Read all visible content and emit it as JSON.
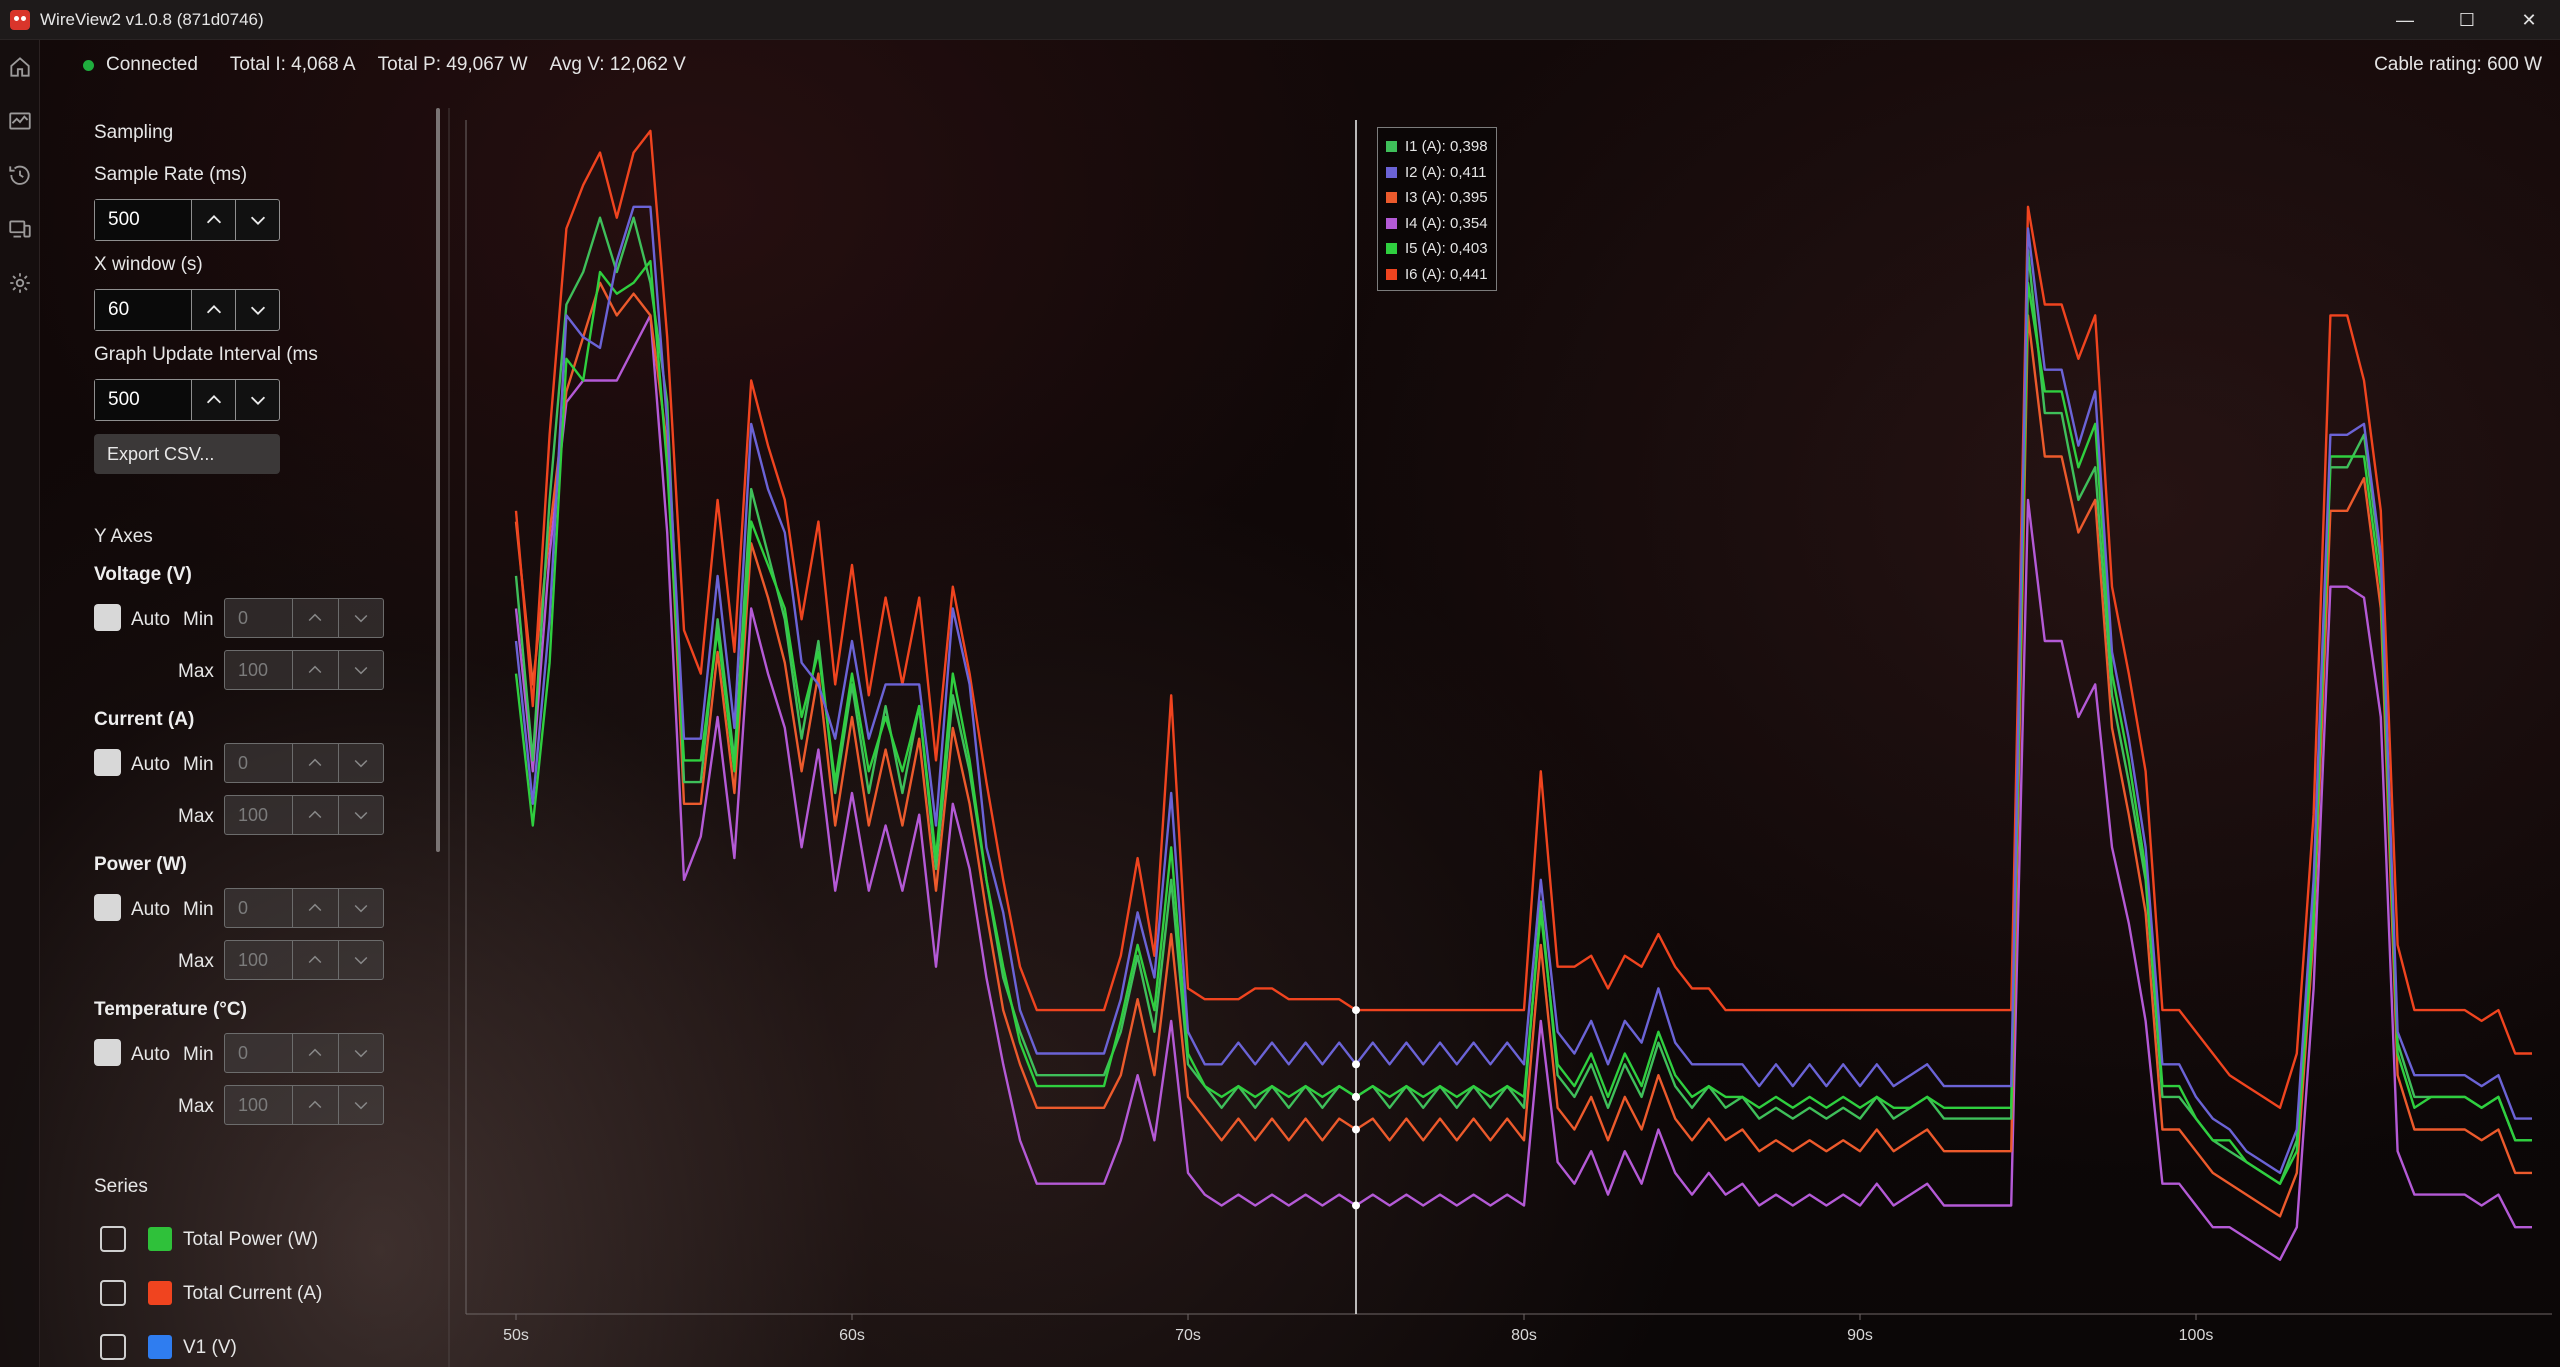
{
  "window": {
    "title": "WireView2 v1.0.8 (871d0746)",
    "controls": [
      "—",
      "☐",
      "✕"
    ]
  },
  "status": {
    "connection": "Connected",
    "total_i": "Total I: 4,068 A",
    "total_p": "Total P: 49,067 W",
    "avg_v": "Avg V: 12,062 V",
    "cable_rating": "Cable rating: 600 W"
  },
  "nav": [
    "home-icon",
    "monitor-graph-icon",
    "history-icon",
    "devices-icon",
    "settings-icon"
  ],
  "sampling": {
    "title": "Sampling",
    "sample_rate_label": "Sample Rate (ms)",
    "sample_rate_value": "500",
    "x_window_label": "X window (s)",
    "x_window_value": "60",
    "graph_update_label": "Graph Update Interval (ms",
    "graph_update_value": "500",
    "export_label": "Export CSV..."
  },
  "y_axes": {
    "title": "Y Axes",
    "auto_label": "Auto",
    "min_label": "Min",
    "max_label": "Max",
    "groups": [
      {
        "title": "Voltage (V)",
        "min": "0",
        "max": "100",
        "auto": true
      },
      {
        "title": "Current (A)",
        "min": "0",
        "max": "100",
        "auto": true
      },
      {
        "title": "Power (W)",
        "min": "0",
        "max": "100",
        "auto": true
      },
      {
        "title": "Temperature (°C)",
        "min": "0",
        "max": "100",
        "auto": true
      }
    ]
  },
  "series_panel": {
    "title": "Series",
    "items": [
      {
        "label": "Total Power (W)",
        "color": "#2fc13a",
        "checked": false
      },
      {
        "label": "Total Current (A)",
        "color": "#f0441f",
        "checked": false
      },
      {
        "label": "V1 (V)",
        "color": "#2f7df0",
        "checked": false
      }
    ]
  },
  "legend": [
    {
      "label": "I1 (A): 0,398",
      "color": "#3fbf5a"
    },
    {
      "label": "I2 (A): 0,411",
      "color": "#6b63d6"
    },
    {
      "label": "I3 (A): 0,395",
      "color": "#ec5a2c"
    },
    {
      "label": "I4 (A): 0,354",
      "color": "#b45ad6"
    },
    {
      "label": "I5 (A): 0,403",
      "color": "#2fcf3f"
    },
    {
      "label": "I6 (A): 0,441",
      "color": "#f0441f"
    }
  ],
  "chart_data": {
    "type": "line",
    "x_ticks": [
      "50s",
      "60s",
      "70s",
      "80s",
      "90s",
      "100s"
    ],
    "x_range": [
      50,
      110
    ],
    "y_range": [
      0,
      1.1
    ],
    "grid": false,
    "legend_position": "top, next to cursor",
    "cursor_x": 75,
    "x": [
      50,
      50.5,
      51,
      51.5,
      52,
      52.5,
      53,
      53.5,
      54,
      54.5,
      55,
      55.5,
      56,
      56.5,
      57,
      57.5,
      58,
      58.5,
      59,
      59.5,
      60,
      60.5,
      61,
      61.5,
      62,
      62.5,
      63,
      63.5,
      64,
      64.5,
      65,
      65.5,
      66,
      66.5,
      67,
      67.5,
      68,
      68.5,
      69,
      69.5,
      70,
      70.5,
      71,
      71.5,
      72,
      72.5,
      73,
      73.5,
      74,
      74.5,
      75,
      75.5,
      76,
      76.5,
      77,
      77.5,
      78,
      78.5,
      79,
      79.5,
      80,
      80.5,
      81,
      81.5,
      82,
      82.5,
      83,
      83.5,
      84,
      84.5,
      85,
      85.5,
      86,
      86.5,
      87,
      87.5,
      88,
      88.5,
      89,
      89.5,
      90,
      90.5,
      91,
      91.5,
      92,
      92.5,
      93,
      93.5,
      94,
      94.5,
      95,
      95.5,
      96,
      96.5,
      97,
      97.5,
      98,
      98.5,
      99,
      99.5,
      100,
      100.5,
      101,
      101.5,
      102,
      102.5,
      103,
      103.5,
      104,
      104.5,
      105,
      105.5,
      106,
      106.5,
      107,
      107.5,
      108,
      108.5,
      109,
      109.5,
      110
    ],
    "series": [
      {
        "name": "I1 (A)",
        "values": [
          0.68,
          0.51,
          0.75,
          0.93,
          0.96,
          1.01,
          0.96,
          1.01,
          0.95,
          0.84,
          0.49,
          0.49,
          0.64,
          0.51,
          0.76,
          0.7,
          0.64,
          0.53,
          0.62,
          0.48,
          0.58,
          0.48,
          0.56,
          0.48,
          0.56,
          0.41,
          0.57,
          0.5,
          0.4,
          0.31,
          0.26,
          0.22,
          0.22,
          0.22,
          0.22,
          0.22,
          0.26,
          0.33,
          0.26,
          0.4,
          0.23,
          0.21,
          0.19,
          0.21,
          0.19,
          0.21,
          0.19,
          0.21,
          0.19,
          0.21,
          0.2,
          0.21,
          0.19,
          0.21,
          0.19,
          0.21,
          0.19,
          0.21,
          0.19,
          0.21,
          0.19,
          0.38,
          0.22,
          0.2,
          0.23,
          0.19,
          0.23,
          0.2,
          0.25,
          0.21,
          0.19,
          0.21,
          0.19,
          0.2,
          0.18,
          0.19,
          0.18,
          0.19,
          0.18,
          0.19,
          0.18,
          0.2,
          0.18,
          0.19,
          0.2,
          0.18,
          0.18,
          0.18,
          0.18,
          0.18,
          0.98,
          0.83,
          0.83,
          0.75,
          0.78,
          0.57,
          0.49,
          0.4,
          0.2,
          0.2,
          0.18,
          0.16,
          0.15,
          0.14,
          0.13,
          0.12,
          0.16,
          0.38,
          0.78,
          0.78,
          0.81,
          0.69,
          0.25,
          0.2,
          0.2,
          0.2,
          0.2,
          0.19,
          0.2,
          0.16,
          0.16
        ]
      },
      {
        "name": "I2 (A)",
        "values": [
          0.62,
          0.47,
          0.64,
          0.92,
          0.9,
          0.89,
          0.97,
          1.02,
          1.02,
          0.82,
          0.53,
          0.53,
          0.68,
          0.54,
          0.82,
          0.76,
          0.72,
          0.6,
          0.58,
          0.53,
          0.62,
          0.53,
          0.58,
          0.58,
          0.58,
          0.45,
          0.65,
          0.58,
          0.43,
          0.37,
          0.28,
          0.24,
          0.24,
          0.24,
          0.24,
          0.24,
          0.29,
          0.37,
          0.31,
          0.48,
          0.26,
          0.23,
          0.23,
          0.25,
          0.23,
          0.25,
          0.23,
          0.25,
          0.23,
          0.25,
          0.23,
          0.25,
          0.23,
          0.25,
          0.23,
          0.25,
          0.23,
          0.25,
          0.23,
          0.25,
          0.23,
          0.4,
          0.26,
          0.24,
          0.27,
          0.23,
          0.27,
          0.25,
          0.3,
          0.25,
          0.23,
          0.23,
          0.23,
          0.23,
          0.21,
          0.23,
          0.21,
          0.23,
          0.21,
          0.23,
          0.21,
          0.23,
          0.21,
          0.22,
          0.23,
          0.21,
          0.21,
          0.21,
          0.21,
          0.21,
          1.0,
          0.87,
          0.87,
          0.8,
          0.85,
          0.61,
          0.53,
          0.43,
          0.23,
          0.23,
          0.2,
          0.18,
          0.17,
          0.15,
          0.14,
          0.13,
          0.17,
          0.4,
          0.81,
          0.81,
          0.82,
          0.7,
          0.26,
          0.22,
          0.22,
          0.22,
          0.22,
          0.21,
          0.22,
          0.18,
          0.18
        ]
      },
      {
        "name": "I3 (A)",
        "values": [
          0.73,
          0.58,
          0.72,
          0.85,
          0.9,
          0.95,
          0.92,
          0.94,
          0.92,
          0.8,
          0.47,
          0.47,
          0.61,
          0.48,
          0.71,
          0.66,
          0.6,
          0.5,
          0.59,
          0.45,
          0.55,
          0.45,
          0.52,
          0.45,
          0.53,
          0.39,
          0.54,
          0.47,
          0.37,
          0.28,
          0.23,
          0.19,
          0.19,
          0.19,
          0.19,
          0.19,
          0.22,
          0.29,
          0.22,
          0.35,
          0.2,
          0.18,
          0.16,
          0.18,
          0.16,
          0.18,
          0.16,
          0.18,
          0.16,
          0.18,
          0.17,
          0.18,
          0.16,
          0.18,
          0.16,
          0.18,
          0.16,
          0.18,
          0.16,
          0.18,
          0.16,
          0.34,
          0.19,
          0.17,
          0.2,
          0.16,
          0.2,
          0.17,
          0.22,
          0.18,
          0.16,
          0.18,
          0.16,
          0.17,
          0.15,
          0.16,
          0.15,
          0.16,
          0.15,
          0.16,
          0.15,
          0.17,
          0.15,
          0.16,
          0.17,
          0.15,
          0.15,
          0.15,
          0.15,
          0.15,
          0.92,
          0.79,
          0.79,
          0.72,
          0.75,
          0.54,
          0.46,
          0.37,
          0.17,
          0.17,
          0.15,
          0.13,
          0.12,
          0.11,
          0.1,
          0.09,
          0.13,
          0.35,
          0.74,
          0.74,
          0.77,
          0.65,
          0.22,
          0.17,
          0.17,
          0.17,
          0.17,
          0.16,
          0.17,
          0.13,
          0.13
        ]
      },
      {
        "name": "I4 (A)",
        "values": [
          0.65,
          0.5,
          0.7,
          0.84,
          0.86,
          0.86,
          0.86,
          0.89,
          0.92,
          0.72,
          0.4,
          0.44,
          0.55,
          0.42,
          0.65,
          0.59,
          0.54,
          0.43,
          0.52,
          0.39,
          0.48,
          0.39,
          0.45,
          0.39,
          0.46,
          0.32,
          0.47,
          0.41,
          0.31,
          0.23,
          0.16,
          0.12,
          0.12,
          0.12,
          0.12,
          0.12,
          0.16,
          0.22,
          0.16,
          0.27,
          0.13,
          0.11,
          0.1,
          0.11,
          0.1,
          0.11,
          0.1,
          0.11,
          0.1,
          0.11,
          0.1,
          0.11,
          0.1,
          0.11,
          0.1,
          0.11,
          0.1,
          0.11,
          0.1,
          0.11,
          0.1,
          0.27,
          0.14,
          0.12,
          0.15,
          0.11,
          0.15,
          0.12,
          0.17,
          0.13,
          0.11,
          0.13,
          0.11,
          0.12,
          0.1,
          0.11,
          0.1,
          0.11,
          0.1,
          0.11,
          0.1,
          0.12,
          0.1,
          0.11,
          0.12,
          0.1,
          0.1,
          0.1,
          0.1,
          0.1,
          0.75,
          0.62,
          0.62,
          0.55,
          0.58,
          0.43,
          0.36,
          0.27,
          0.12,
          0.12,
          0.1,
          0.08,
          0.08,
          0.07,
          0.06,
          0.05,
          0.08,
          0.3,
          0.67,
          0.67,
          0.66,
          0.55,
          0.15,
          0.11,
          0.11,
          0.11,
          0.11,
          0.1,
          0.11,
          0.08,
          0.08
        ]
      },
      {
        "name": "I5 (A)",
        "values": [
          0.59,
          0.45,
          0.6,
          0.88,
          0.86,
          0.96,
          0.94,
          0.95,
          0.97,
          0.78,
          0.51,
          0.51,
          0.63,
          0.5,
          0.73,
          0.69,
          0.65,
          0.55,
          0.61,
          0.49,
          0.59,
          0.5,
          0.55,
          0.5,
          0.56,
          0.42,
          0.59,
          0.51,
          0.4,
          0.32,
          0.25,
          0.21,
          0.21,
          0.21,
          0.21,
          0.21,
          0.27,
          0.34,
          0.28,
          0.43,
          0.24,
          0.21,
          0.2,
          0.21,
          0.2,
          0.21,
          0.2,
          0.21,
          0.2,
          0.21,
          0.2,
          0.21,
          0.2,
          0.21,
          0.2,
          0.21,
          0.2,
          0.21,
          0.2,
          0.21,
          0.2,
          0.37,
          0.23,
          0.21,
          0.24,
          0.2,
          0.24,
          0.21,
          0.26,
          0.22,
          0.2,
          0.21,
          0.2,
          0.2,
          0.19,
          0.2,
          0.19,
          0.2,
          0.19,
          0.2,
          0.19,
          0.2,
          0.19,
          0.19,
          0.2,
          0.19,
          0.19,
          0.19,
          0.19,
          0.19,
          0.95,
          0.85,
          0.85,
          0.78,
          0.82,
          0.59,
          0.51,
          0.41,
          0.21,
          0.21,
          0.18,
          0.16,
          0.16,
          0.14,
          0.13,
          0.12,
          0.15,
          0.36,
          0.79,
          0.79,
          0.79,
          0.67,
          0.24,
          0.19,
          0.2,
          0.2,
          0.2,
          0.19,
          0.2,
          0.16,
          0.16
        ]
      },
      {
        "name": "I6 (A)",
        "values": [
          0.74,
          0.56,
          0.81,
          1.0,
          1.04,
          1.07,
          1.01,
          1.07,
          1.09,
          0.9,
          0.63,
          0.59,
          0.75,
          0.61,
          0.86,
          0.8,
          0.75,
          0.64,
          0.73,
          0.58,
          0.69,
          0.57,
          0.66,
          0.58,
          0.66,
          0.51,
          0.67,
          0.59,
          0.49,
          0.4,
          0.32,
          0.28,
          0.28,
          0.28,
          0.28,
          0.28,
          0.33,
          0.42,
          0.33,
          0.57,
          0.3,
          0.29,
          0.29,
          0.29,
          0.3,
          0.3,
          0.29,
          0.29,
          0.29,
          0.29,
          0.28,
          0.28,
          0.28,
          0.28,
          0.28,
          0.28,
          0.28,
          0.28,
          0.28,
          0.28,
          0.28,
          0.5,
          0.32,
          0.32,
          0.33,
          0.3,
          0.33,
          0.32,
          0.35,
          0.32,
          0.3,
          0.3,
          0.28,
          0.28,
          0.28,
          0.28,
          0.28,
          0.28,
          0.28,
          0.28,
          0.28,
          0.28,
          0.28,
          0.28,
          0.28,
          0.28,
          0.28,
          0.28,
          0.28,
          0.28,
          1.02,
          0.93,
          0.93,
          0.88,
          0.92,
          0.67,
          0.59,
          0.5,
          0.28,
          0.28,
          0.26,
          0.24,
          0.22,
          0.21,
          0.2,
          0.19,
          0.24,
          0.46,
          0.92,
          0.92,
          0.86,
          0.74,
          0.34,
          0.28,
          0.28,
          0.28,
          0.28,
          0.27,
          0.28,
          0.24,
          0.24
        ]
      }
    ]
  }
}
